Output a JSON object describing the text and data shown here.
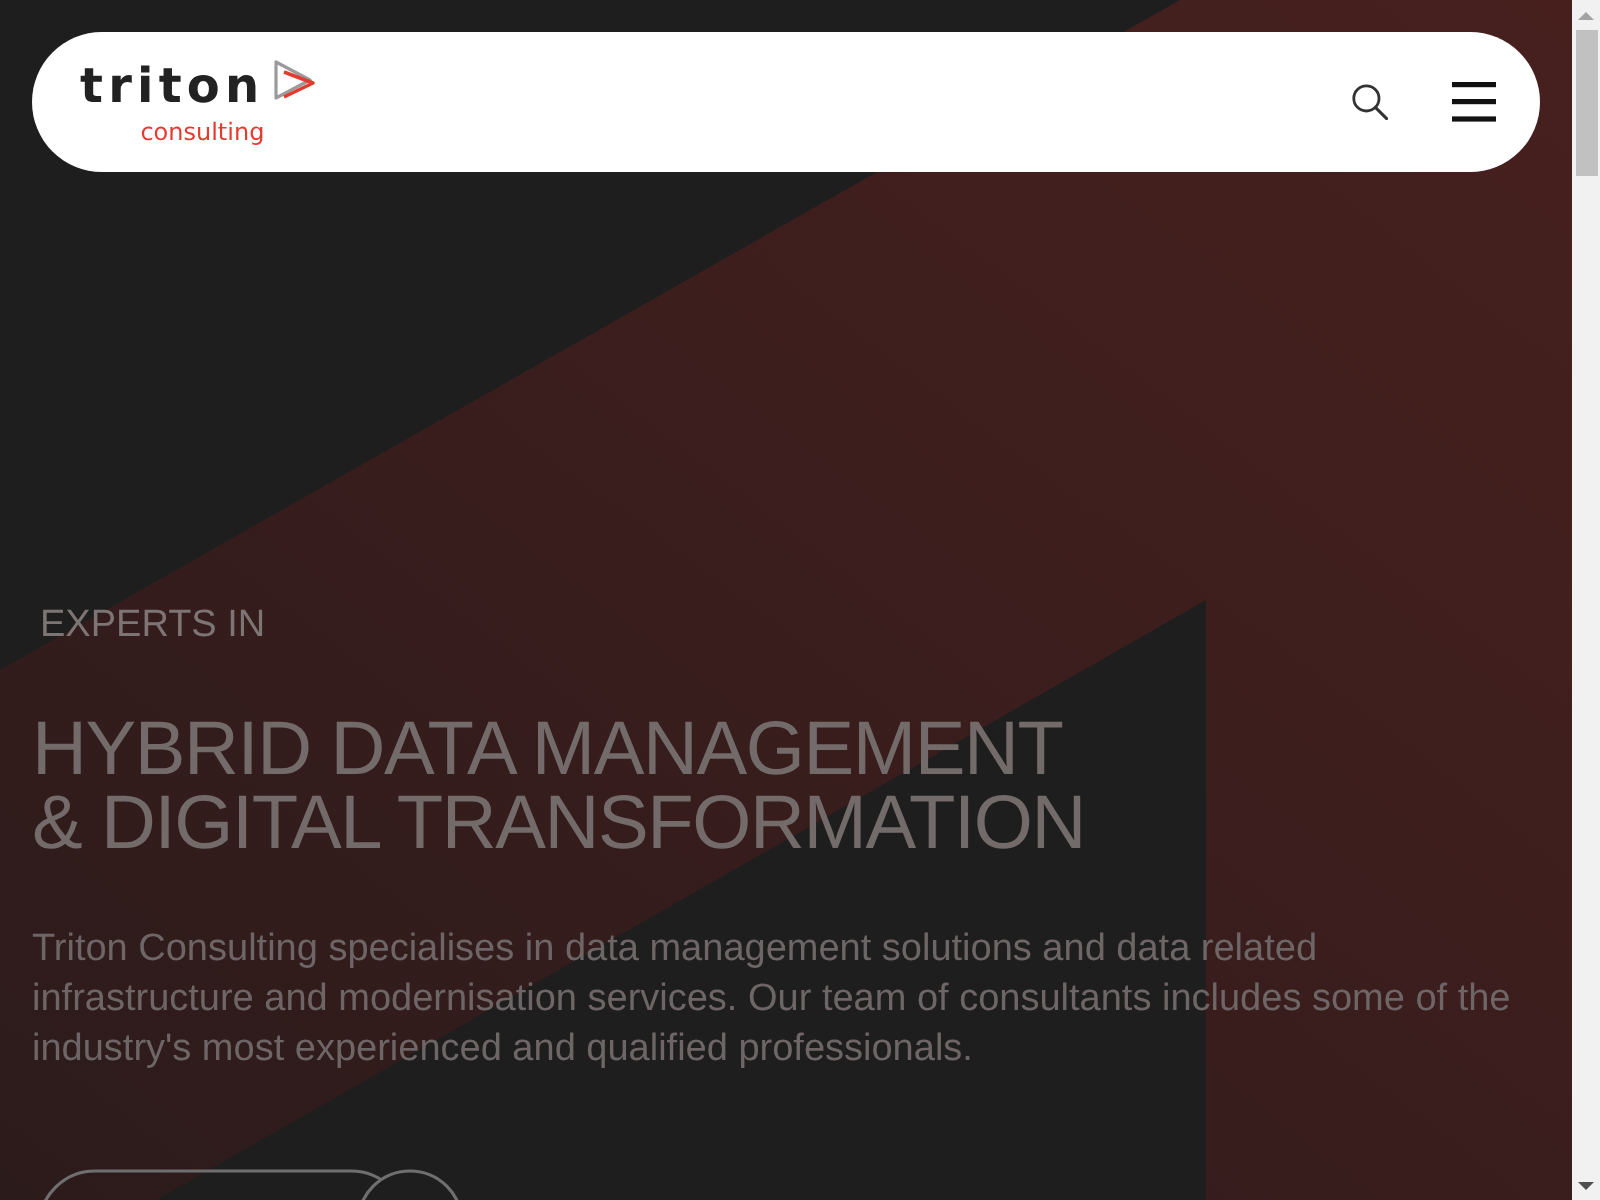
{
  "header": {
    "logo": {
      "wordmark": "triton",
      "tagline": "consulting"
    }
  },
  "hero": {
    "eyebrow": "EXPERTS IN",
    "heading_lines": [
      "HYBRID DATA MANAGEMENT",
      "& DIGITAL TRANSFORMATION"
    ],
    "description": "Triton Consulting specialises in data management solutions and data related infrastructure and modernisation services. Our team of consultants includes some of the industry's most experienced and qualified professionals."
  }
}
